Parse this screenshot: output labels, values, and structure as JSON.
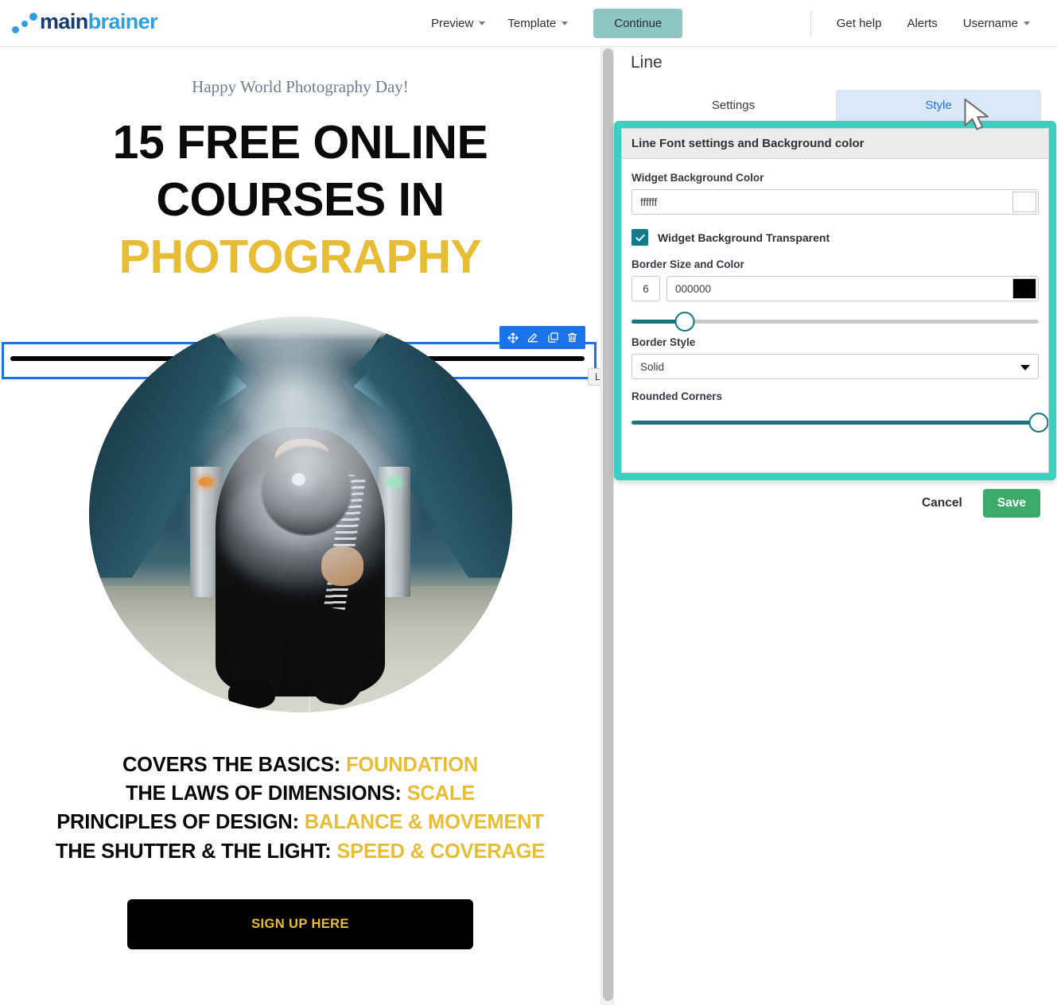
{
  "brand": {
    "part1": "main",
    "part2": "brainer"
  },
  "topnav": {
    "center": [
      {
        "label": "Preview",
        "has_caret": true
      },
      {
        "label": "Template",
        "has_caret": true
      }
    ],
    "continue_label": "Continue",
    "right": [
      {
        "label": "Get help",
        "has_caret": false
      },
      {
        "label": "Alerts",
        "has_caret": false
      },
      {
        "label": "Username",
        "has_caret": true
      }
    ]
  },
  "email": {
    "preheader": "Happy World Photography Day!",
    "headline_line1": "15 FREE ONLINE",
    "headline_line2": "COURSES IN",
    "headline_line3": "PHOTOGRAPHY",
    "bullets": [
      {
        "black": "COVERS THE BASICS:",
        "yellow": "FOUNDATION"
      },
      {
        "black": "THE LAWS OF DIMENSIONS:",
        "yellow": "SCALE"
      },
      {
        "black": "PRINCIPLES OF DESIGN:",
        "yellow": "BALANCE & MOVEMENT"
      },
      {
        "black": "THE SHUTTER & THE LIGHT:",
        "yellow": "SPEED & COVERAGE"
      }
    ],
    "cta_label": "SIGN UP HERE",
    "accent_color": "#e8bd36",
    "cta_background": "#000000"
  },
  "selected_widget": {
    "tag_label": "Line",
    "selection_color": "#1a73e8",
    "toolbar": [
      {
        "icon": "move-icon"
      },
      {
        "icon": "edit-pencil-icon"
      },
      {
        "icon": "duplicate-icon"
      },
      {
        "icon": "trash-icon"
      }
    ]
  },
  "panel": {
    "title": "Line",
    "tabs": [
      {
        "label": "Settings",
        "active": false
      },
      {
        "label": "Style",
        "active": true
      }
    ],
    "card_title": "Line Font settings and Background color",
    "highlight_color": "#3ccfc0",
    "fields": {
      "widget_bg_label": "Widget Background Color",
      "widget_bg_value": "ffffff",
      "widget_bg_placeholder": "ffffff",
      "transparent_label": "Widget Background Transparent",
      "transparent_checked": true,
      "border_label": "Border Size and Color",
      "border_size_value": "6",
      "border_color_value": "000000",
      "border_color_placeholder": "000000",
      "border_size_percent": 13,
      "border_style_label": "Border Style",
      "border_style_value": "Solid",
      "rounded_label": "Rounded Corners",
      "rounded_percent": 100
    },
    "cancel_label": "Cancel",
    "save_label": "Save",
    "save_color": "#3cab6a"
  }
}
